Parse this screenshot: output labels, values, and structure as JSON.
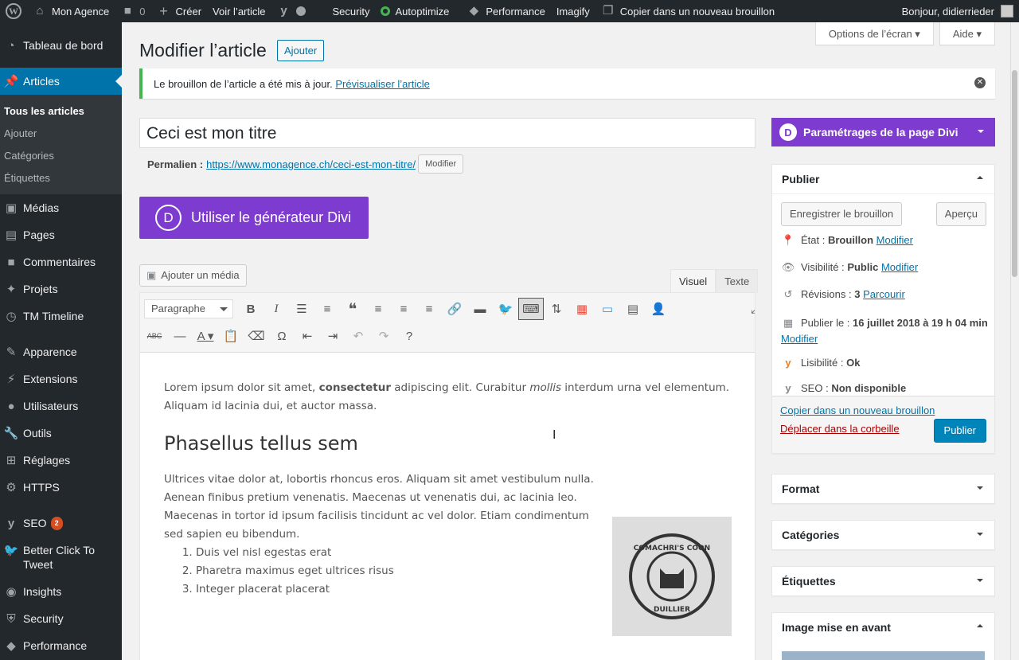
{
  "adminbar": {
    "site_name": "Mon Agence",
    "comments_count": "0",
    "new_label": "Créer",
    "view_label": "Voir l’article",
    "security_label": "Security",
    "autoptimize_label": "Autoptimize",
    "performance_label": "Performance",
    "imagify_label": "Imagify",
    "copy_label": "Copier dans un nouveau brouillon",
    "greeting": "Bonjour, didierrieder"
  },
  "menu": {
    "dashboard": "Tableau de bord",
    "articles": "Articles",
    "sub": [
      "Tous les articles",
      "Ajouter",
      "Catégories",
      "Étiquettes"
    ],
    "items": [
      "Médias",
      "Pages",
      "Commentaires",
      "Projets",
      "TM Timeline",
      "Apparence",
      "Extensions",
      "Utilisateurs",
      "Outils",
      "Réglages",
      "HTTPS",
      "SEO",
      "Better Click To Tweet",
      "Insights",
      "Security",
      "Performance"
    ],
    "seo_badge": "2"
  },
  "screen_meta": {
    "options": "Options de l’écran",
    "help": "Aide"
  },
  "page": {
    "title": "Modifier l’article",
    "add_new": "Ajouter",
    "notice_text": "Le brouillon de l’article a été mis à jour.",
    "notice_link": "Prévisualiser l’article",
    "post_title": "Ceci est mon titre",
    "permalink_label": "Permalien :",
    "permalink_url": "https://www.monagence.ch/ceci-est-mon-titre/",
    "permalink_edit": "Modifier",
    "divi_builder": "Utiliser le générateur Divi",
    "add_media": "Ajouter un média",
    "tab_visual": "Visuel",
    "tab_text": "Texte",
    "format_select": "Paragraphe"
  },
  "content": {
    "p1_a": "Lorem ipsum dolor sit amet, ",
    "p1_b": "consectetur",
    "p1_c": " adipiscing elit. Curabitur ",
    "p1_d": "mollis",
    "p1_e": " interdum urna vel elementum. Aliquam id lacinia dui, et auctor massa.",
    "h2": "Phasellus tellus sem",
    "p2": "Ultrices vitae dolor at, lobortis rhoncus eros. Aliquam sit amet vestibulum nulla. Aenean finibus pretium venenatis. Maecenas ut venenatis dui, ac lacinia leo. Maecenas in tortor id ipsum facilisis tincidunt ac vel dolor. Etiam condimentum sed sapien eu bibendum.",
    "list": [
      "Duis vel nisl egestas erat",
      "Pharetra maximus eget ultrices risus",
      "Integer placerat placerat"
    ],
    "image_text_top": "COMACHRI'S COON",
    "image_text_bottom": "DUILLIER"
  },
  "sidebar": {
    "divi_panel": "Paramétrages de la page Divi",
    "publish_title": "Publier",
    "save_draft": "Enregistrer le brouillon",
    "preview": "Aperçu",
    "status_label": "État :",
    "status_value": "Brouillon",
    "visibility_label": "Visibilité :",
    "visibility_value": "Public",
    "revisions_label": "Révisions :",
    "revisions_value": "3",
    "revisions_link": "Parcourir",
    "publish_on_label": "Publier le :",
    "publish_on_value": "16 juillet 2018 à 19 h 04 min",
    "edit_link": "Modifier",
    "readability_label": "Lisibilité :",
    "readability_value": "Ok",
    "seo_label": "SEO :",
    "seo_value": "Non disponible",
    "copy_draft": "Copier dans un nouveau brouillon",
    "trash": "Déplacer dans la corbeille",
    "publish_btn": "Publier",
    "format_title": "Format",
    "categories_title": "Catégories",
    "tags_title": "Étiquettes",
    "featured_title": "Image mise en avant"
  }
}
